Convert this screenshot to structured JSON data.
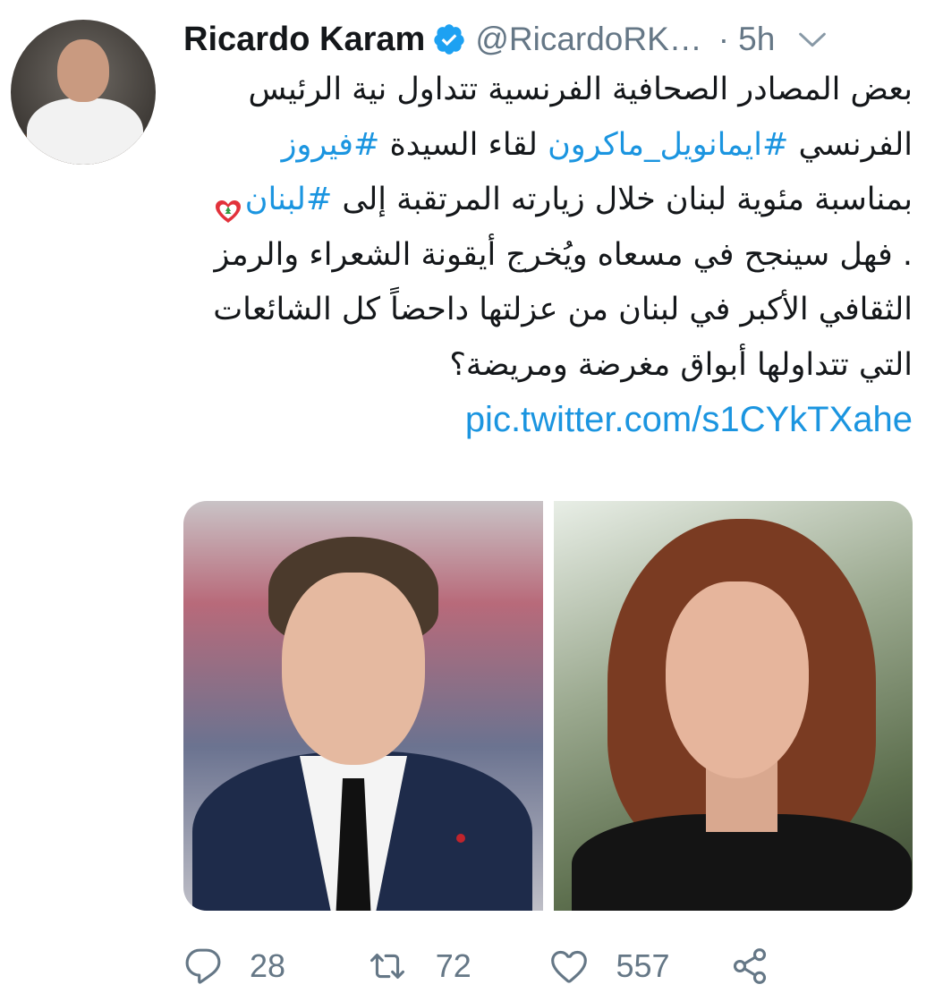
{
  "tweet": {
    "author_name": "Ricardo Karam",
    "handle": "@RicardoRK…",
    "separator": "·",
    "time": "5h",
    "text": {
      "p1": "بعض المصادر الصحافية الفرنسية تتداول نية الرئيس الفرنسي ",
      "hashtag1": "#ايمانويل_ماكرون",
      "p2": " لقاء السيدة ",
      "hashtag2": "#فيروز",
      "p3": " بمناسبة مئوية لبنان خلال زيارته المرتقبة إلى ",
      "hashtag3": "#لبنان",
      "p4": " . فهل سينجح في مسعاه ويُخرج أيقونة الشعراء والرمز الثقافي الأكبر في لبنان من عزلتها داحضاً كل الشائعات التي تتداولها أبواق مغرضة ومريضة؟ ",
      "link": "pic.twitter.com/s1CYkTXahe"
    }
  },
  "actions": {
    "reply_count": "28",
    "retweet_count": "72",
    "like_count": "557"
  },
  "icons": {
    "verified": "verified-badge-icon",
    "caret": "chevron-down-icon",
    "reply": "reply-icon",
    "retweet": "retweet-icon",
    "like": "heart-icon",
    "share": "share-icon",
    "emoji": "lebanon-flag-heart-emoji"
  },
  "colors": {
    "link": "#1b95e0",
    "secondary": "#657786",
    "verified": "#1da1f2"
  }
}
